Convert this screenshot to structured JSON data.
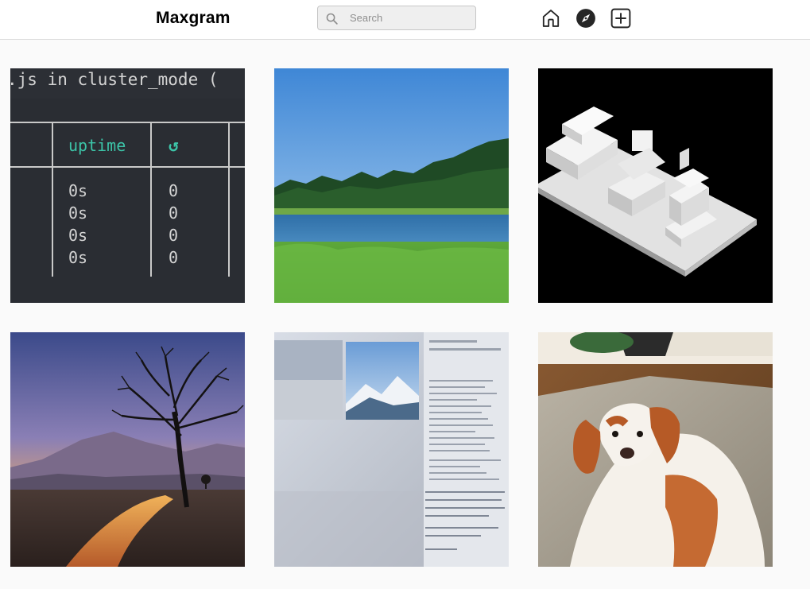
{
  "header": {
    "brand": "Maxgram",
    "search": {
      "placeholder": "Search",
      "value": ""
    },
    "nav": [
      {
        "icon": "home-icon"
      },
      {
        "icon": "compass-icon"
      },
      {
        "icon": "plus-square-icon"
      }
    ]
  },
  "posts": [
    {
      "subject": "terminal-screenshot",
      "code_line": ".js in cluster_mode (",
      "column_header": "uptime",
      "restart_symbol": "↺",
      "rows": [
        {
          "uptime": "0s",
          "restarts": "0"
        },
        {
          "uptime": "0s",
          "restarts": "0"
        },
        {
          "uptime": "0s",
          "restarts": "0"
        },
        {
          "uptime": "0s",
          "restarts": "0"
        }
      ]
    },
    {
      "subject": "lake-landscape"
    },
    {
      "subject": "3d-blocks-render"
    },
    {
      "subject": "tree-sunset-road"
    },
    {
      "subject": "monitor-photo"
    },
    {
      "subject": "dog-on-rug"
    }
  ],
  "colors": {
    "header_bg": "#ffffff",
    "page_bg": "#fafafa",
    "border": "#dbdbdb",
    "terminal_bg": "#2a2d33",
    "terminal_text": "#d4d4d4",
    "terminal_accent": "#3cc4a8"
  }
}
